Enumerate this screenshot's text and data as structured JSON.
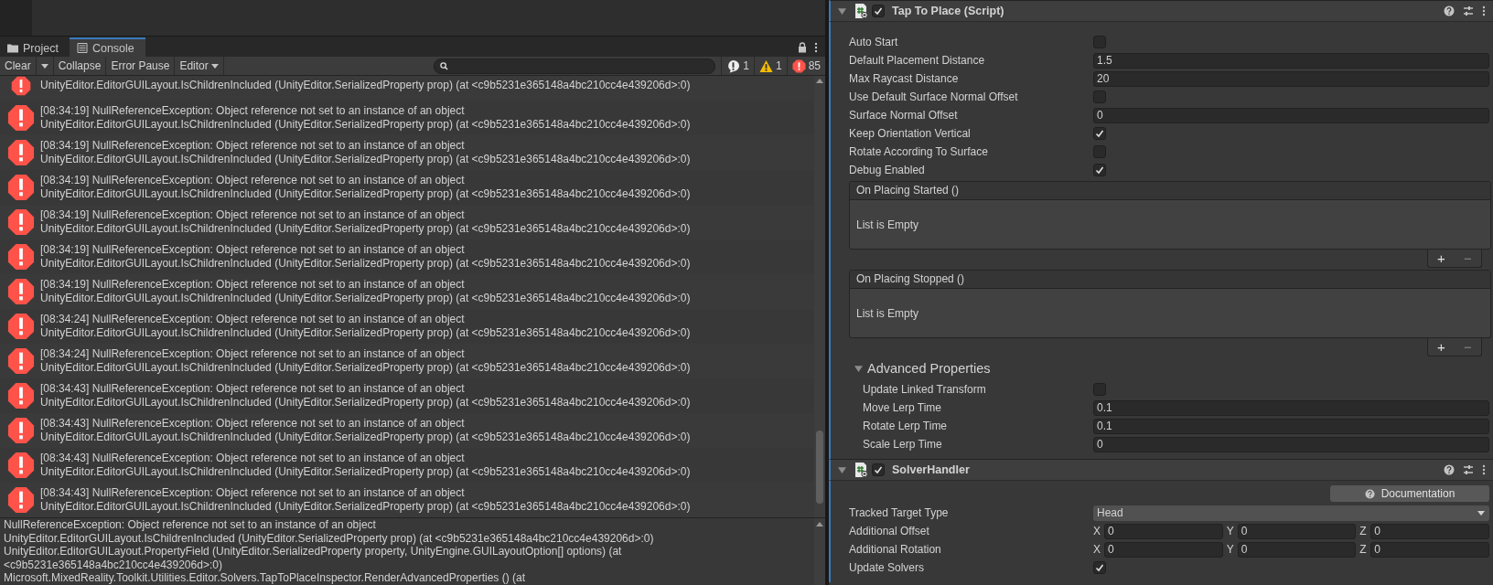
{
  "console": {
    "tabs": [
      {
        "label": "Project",
        "selected": false
      },
      {
        "label": "Console",
        "selected": true
      }
    ],
    "toolbar": [
      {
        "label": "Clear",
        "kind": "split"
      },
      {
        "label": "Collapse",
        "kind": "plain"
      },
      {
        "label": "Error Pause",
        "kind": "plain"
      },
      {
        "label": "Editor",
        "kind": "menu"
      }
    ],
    "counts": [
      {
        "kind": "info",
        "count": "1"
      },
      {
        "kind": "warning",
        "count": "1"
      },
      {
        "kind": "error",
        "count": "85"
      }
    ],
    "entries": [
      {
        "lines": [
          "UnityEditor.EditorGUILayout.IsChildrenIncluded (UnityEditor.SerializedProperty prop) (at <c9b5231e365148a4bc210cc4e439206d>:0)"
        ]
      },
      {
        "lines": [
          "[08:34:19] NullReferenceException: Object reference not set to an instance of an object",
          "UnityEditor.EditorGUILayout.IsChildrenIncluded (UnityEditor.SerializedProperty prop) (at <c9b5231e365148a4bc210cc4e439206d>:0)"
        ]
      },
      {
        "lines": [
          "[08:34:19] NullReferenceException: Object reference not set to an instance of an object",
          "UnityEditor.EditorGUILayout.IsChildrenIncluded (UnityEditor.SerializedProperty prop) (at <c9b5231e365148a4bc210cc4e439206d>:0)"
        ]
      },
      {
        "lines": [
          "[08:34:19] NullReferenceException: Object reference not set to an instance of an object",
          "UnityEditor.EditorGUILayout.IsChildrenIncluded (UnityEditor.SerializedProperty prop) (at <c9b5231e365148a4bc210cc4e439206d>:0)"
        ]
      },
      {
        "lines": [
          "[08:34:19] NullReferenceException: Object reference not set to an instance of an object",
          "UnityEditor.EditorGUILayout.IsChildrenIncluded (UnityEditor.SerializedProperty prop) (at <c9b5231e365148a4bc210cc4e439206d>:0)"
        ]
      },
      {
        "lines": [
          "[08:34:19] NullReferenceException: Object reference not set to an instance of an object",
          "UnityEditor.EditorGUILayout.IsChildrenIncluded (UnityEditor.SerializedProperty prop) (at <c9b5231e365148a4bc210cc4e439206d>:0)"
        ]
      },
      {
        "lines": [
          "[08:34:19] NullReferenceException: Object reference not set to an instance of an object",
          "UnityEditor.EditorGUILayout.IsChildrenIncluded (UnityEditor.SerializedProperty prop) (at <c9b5231e365148a4bc210cc4e439206d>:0)"
        ]
      },
      {
        "lines": [
          "[08:34:24] NullReferenceException: Object reference not set to an instance of an object",
          "UnityEditor.EditorGUILayout.IsChildrenIncluded (UnityEditor.SerializedProperty prop) (at <c9b5231e365148a4bc210cc4e439206d>:0)"
        ]
      },
      {
        "lines": [
          "[08:34:24] NullReferenceException: Object reference not set to an instance of an object",
          "UnityEditor.EditorGUILayout.IsChildrenIncluded (UnityEditor.SerializedProperty prop) (at <c9b5231e365148a4bc210cc4e439206d>:0)"
        ]
      },
      {
        "lines": [
          "[08:34:43] NullReferenceException: Object reference not set to an instance of an object",
          "UnityEditor.EditorGUILayout.IsChildrenIncluded (UnityEditor.SerializedProperty prop) (at <c9b5231e365148a4bc210cc4e439206d>:0)"
        ]
      },
      {
        "lines": [
          "[08:34:43] NullReferenceException: Object reference not set to an instance of an object",
          "UnityEditor.EditorGUILayout.IsChildrenIncluded (UnityEditor.SerializedProperty prop) (at <c9b5231e365148a4bc210cc4e439206d>:0)"
        ]
      },
      {
        "lines": [
          "[08:34:43] NullReferenceException: Object reference not set to an instance of an object",
          "UnityEditor.EditorGUILayout.IsChildrenIncluded (UnityEditor.SerializedProperty prop) (at <c9b5231e365148a4bc210cc4e439206d>:0)"
        ]
      },
      {
        "lines": [
          "[08:34:43] NullReferenceException: Object reference not set to an instance of an object",
          "UnityEditor.EditorGUILayout.IsChildrenIncluded (UnityEditor.SerializedProperty prop) (at <c9b5231e365148a4bc210cc4e439206d>:0)"
        ]
      }
    ],
    "detail": [
      "NullReferenceException: Object reference not set to an instance of an object",
      "UnityEditor.EditorGUILayout.IsChildrenIncluded (UnityEditor.SerializedProperty prop) (at <c9b5231e365148a4bc210cc4e439206d>:0)",
      "UnityEditor.EditorGUILayout.PropertyField (UnityEditor.SerializedProperty property, UnityEngine.GUILayoutOption[] options) (at",
      "<c9b5231e365148a4bc210cc4e439206d>:0)",
      "Microsoft.MixedReality.Toolkit.Utilities.Editor.Solvers.TapToPlaceInspector.RenderAdvancedProperties () (at"
    ]
  },
  "inspector": {
    "components": [
      {
        "title": "Tap To Place (Script)",
        "enabled": true,
        "expanded": true,
        "items": [
          {
            "kind": "checkbox",
            "label": "Auto Start",
            "checked": false
          },
          {
            "kind": "field",
            "label": "Default Placement Distance",
            "value": "1.5"
          },
          {
            "kind": "field",
            "label": "Max Raycast Distance",
            "value": "20"
          },
          {
            "kind": "checkbox",
            "label": "Use Default Surface Normal Offset",
            "checked": false
          },
          {
            "kind": "field",
            "label": "Surface Normal Offset",
            "value": "0"
          },
          {
            "kind": "checkbox",
            "label": "Keep Orientation Vertical",
            "checked": true
          },
          {
            "kind": "checkbox",
            "label": "Rotate According To Surface",
            "checked": false
          },
          {
            "kind": "checkbox",
            "label": "Debug Enabled",
            "checked": true
          },
          {
            "kind": "event",
            "label": "On Placing Started ()",
            "empty": "List is Empty",
            "add": "+",
            "remove": "−"
          },
          {
            "kind": "event",
            "label": "On Placing Stopped ()",
            "empty": "List is Empty",
            "add": "+",
            "remove": "−"
          },
          {
            "kind": "foldout",
            "label": "Advanced Properties",
            "expanded": true,
            "children": [
              {
                "kind": "checkbox",
                "label": "Update Linked Transform",
                "checked": false
              },
              {
                "kind": "field",
                "label": "Move Lerp Time",
                "value": "0.1"
              },
              {
                "kind": "field",
                "label": "Rotate Lerp Time",
                "value": "0.1"
              },
              {
                "kind": "field",
                "label": "Scale Lerp Time",
                "value": "0"
              }
            ]
          }
        ]
      },
      {
        "title": "SolverHandler",
        "enabled": true,
        "expanded": true,
        "items": [
          {
            "kind": "button",
            "label": "Documentation"
          },
          {
            "kind": "enum",
            "label": "Tracked Target Type",
            "value": "Head"
          },
          {
            "kind": "vector3",
            "label": "Additional Offset",
            "axes": [
              {
                "axis": "X",
                "value": "0"
              },
              {
                "axis": "Y",
                "value": "0"
              },
              {
                "axis": "Z",
                "value": "0"
              }
            ]
          },
          {
            "kind": "vector3",
            "label": "Additional Rotation",
            "axes": [
              {
                "axis": "X",
                "value": "0"
              },
              {
                "axis": "Y",
                "value": "0"
              },
              {
                "axis": "Z",
                "value": "0"
              }
            ]
          },
          {
            "kind": "checkbox",
            "label": "Update Solvers",
            "checked": true
          }
        ]
      }
    ]
  }
}
